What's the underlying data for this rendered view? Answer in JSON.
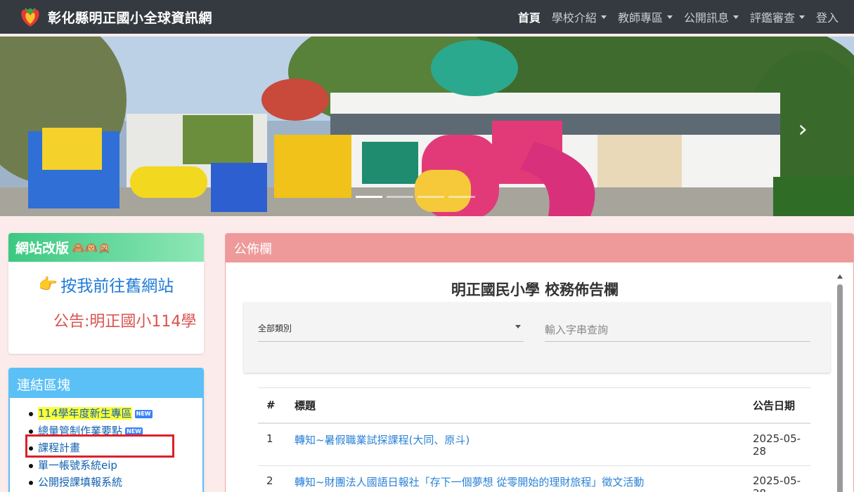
{
  "site": {
    "title": "彰化縣明正國小全球資訊網"
  },
  "nav": {
    "items": [
      {
        "label": "首頁",
        "active": true,
        "dropdown": false
      },
      {
        "label": "學校介紹",
        "active": false,
        "dropdown": true
      },
      {
        "label": "教師專區",
        "active": false,
        "dropdown": true
      },
      {
        "label": "公開訊息",
        "active": false,
        "dropdown": true
      },
      {
        "label": "評鑑審查",
        "active": false,
        "dropdown": true
      },
      {
        "label": "登入",
        "active": false,
        "dropdown": false
      }
    ]
  },
  "sidebar": {
    "revision": {
      "title": "網站改版",
      "emoji": "🙈🙉🙊",
      "link_emoji": "👉",
      "link_text": "按我前往舊網站",
      "notice": "公告:明正國小114學"
    },
    "links": {
      "title": "連結區塊",
      "items": [
        {
          "label": "114學年度新生專區",
          "badge": "NEW"
        },
        {
          "label": "總量管制作業要點",
          "badge": "NEW"
        },
        {
          "label": "課程計畫",
          "badge": ""
        },
        {
          "label": "單一帳號系統eip",
          "badge": ""
        },
        {
          "label": "公開授課填報系統",
          "badge": ""
        }
      ]
    }
  },
  "main": {
    "panel_title": "公佈欄",
    "board_title": "明正國民小學 校務佈告欄",
    "filter": {
      "category": "全部類別",
      "search_placeholder": "輸入字串查詢"
    },
    "table": {
      "headers": [
        "#",
        "標題",
        "公告日期"
      ],
      "rows": [
        {
          "n": "1",
          "title": "轉知~暑假職業試探課程(大同、原斗)",
          "date": "2025-05-28"
        },
        {
          "n": "2",
          "title": "轉知~財團法人國語日報社「存下一個夢想 從零開始的理財旅程」徵文活動",
          "date": "2025-05-28"
        }
      ]
    }
  },
  "colors": {
    "navbar": "#343a40",
    "revision_header": "#3cc882",
    "links_header": "#5bc0f5",
    "panel_header": "#ee9a9a",
    "link_text": "#2a82d7",
    "highlight_box": "#dd1f2a"
  }
}
